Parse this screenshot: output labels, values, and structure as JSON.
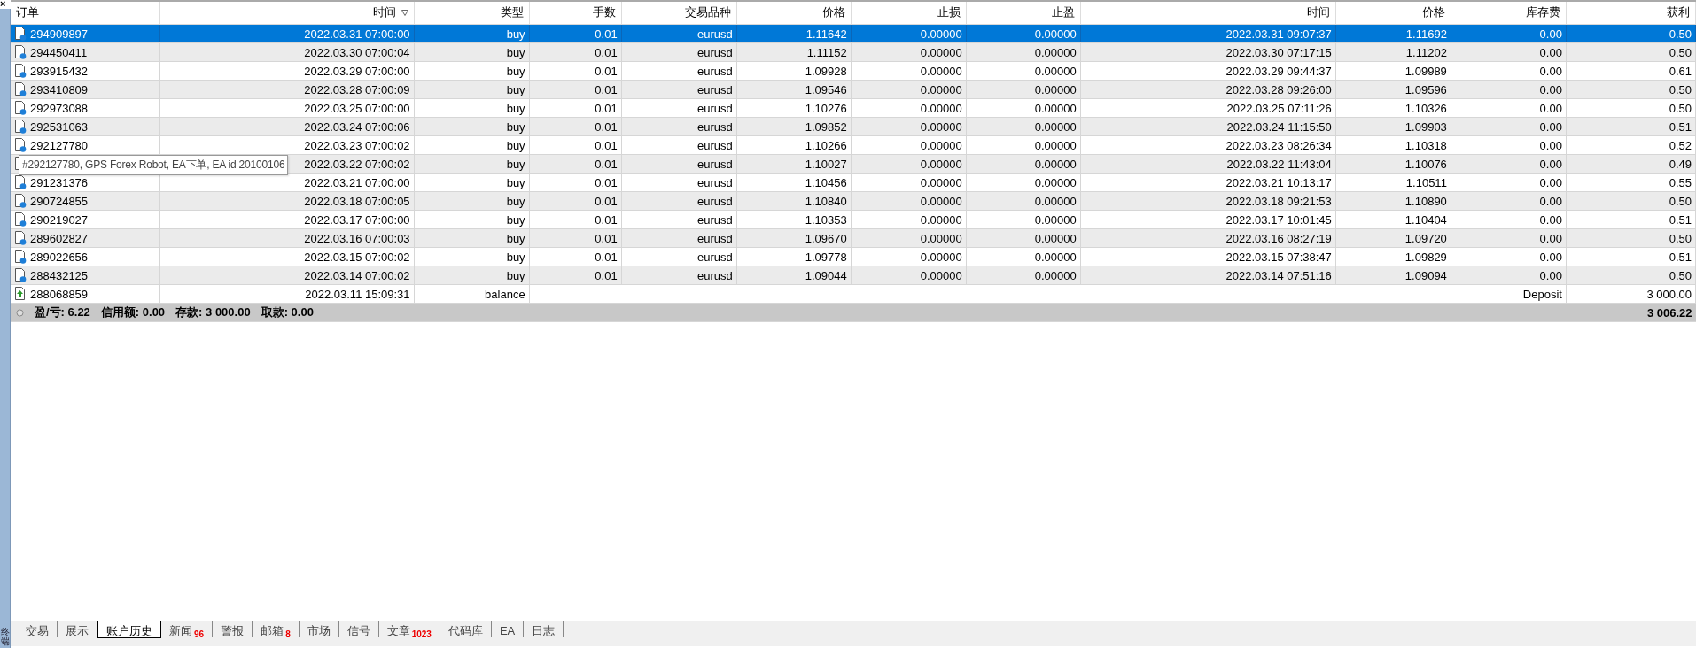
{
  "side_panel": {
    "close": "×",
    "label": "终端"
  },
  "table": {
    "columns": [
      {
        "label": "订单"
      },
      {
        "label": "时间",
        "sorted": true
      },
      {
        "label": "类型"
      },
      {
        "label": "手数"
      },
      {
        "label": "交易品种"
      },
      {
        "label": "价格"
      },
      {
        "label": "止损"
      },
      {
        "label": "止盈"
      },
      {
        "label": "时间"
      },
      {
        "label": "价格"
      },
      {
        "label": "库存费"
      },
      {
        "label": "获利"
      }
    ],
    "rows": [
      {
        "kind": "order",
        "selected": true,
        "cells": [
          "294909897",
          "2022.03.31 07:00:00",
          "buy",
          "0.01",
          "eurusd",
          "1.11642",
          "0.00000",
          "0.00000",
          "2022.03.31 09:07:37",
          "1.11692",
          "0.00",
          "0.50"
        ]
      },
      {
        "kind": "order",
        "selected": false,
        "cells": [
          "294450411",
          "2022.03.30 07:00:04",
          "buy",
          "0.01",
          "eurusd",
          "1.11152",
          "0.00000",
          "0.00000",
          "2022.03.30 07:17:15",
          "1.11202",
          "0.00",
          "0.50"
        ]
      },
      {
        "kind": "order",
        "selected": false,
        "cells": [
          "293915432",
          "2022.03.29 07:00:00",
          "buy",
          "0.01",
          "eurusd",
          "1.09928",
          "0.00000",
          "0.00000",
          "2022.03.29 09:44:37",
          "1.09989",
          "0.00",
          "0.61"
        ]
      },
      {
        "kind": "order",
        "selected": false,
        "cells": [
          "293410809",
          "2022.03.28 07:00:09",
          "buy",
          "0.01",
          "eurusd",
          "1.09546",
          "0.00000",
          "0.00000",
          "2022.03.28 09:26:00",
          "1.09596",
          "0.00",
          "0.50"
        ]
      },
      {
        "kind": "order",
        "selected": false,
        "cells": [
          "292973088",
          "2022.03.25 07:00:00",
          "buy",
          "0.01",
          "eurusd",
          "1.10276",
          "0.00000",
          "0.00000",
          "2022.03.25 07:11:26",
          "1.10326",
          "0.00",
          "0.50"
        ]
      },
      {
        "kind": "order",
        "selected": false,
        "cells": [
          "292531063",
          "2022.03.24 07:00:06",
          "buy",
          "0.01",
          "eurusd",
          "1.09852",
          "0.00000",
          "0.00000",
          "2022.03.24 11:15:50",
          "1.09903",
          "0.00",
          "0.51"
        ]
      },
      {
        "kind": "order",
        "selected": false,
        "cells": [
          "292127780",
          "2022.03.23 07:00:02",
          "buy",
          "0.01",
          "eurusd",
          "1.10266",
          "0.00000",
          "0.00000",
          "2022.03.23 08:26:34",
          "1.10318",
          "0.00",
          "0.52"
        ]
      },
      {
        "kind": "order",
        "selected": false,
        "cells": [
          "",
          "2022.03.22 07:00:02",
          "buy",
          "0.01",
          "eurusd",
          "1.10027",
          "0.00000",
          "0.00000",
          "2022.03.22 11:43:04",
          "1.10076",
          "0.00",
          "0.49"
        ]
      },
      {
        "kind": "order",
        "selected": false,
        "cells": [
          "291231376",
          "2022.03.21 07:00:00",
          "buy",
          "0.01",
          "eurusd",
          "1.10456",
          "0.00000",
          "0.00000",
          "2022.03.21 10:13:17",
          "1.10511",
          "0.00",
          "0.55"
        ]
      },
      {
        "kind": "order",
        "selected": false,
        "cells": [
          "290724855",
          "2022.03.18 07:00:05",
          "buy",
          "0.01",
          "eurusd",
          "1.10840",
          "0.00000",
          "0.00000",
          "2022.03.18 09:21:53",
          "1.10890",
          "0.00",
          "0.50"
        ]
      },
      {
        "kind": "order",
        "selected": false,
        "cells": [
          "290219027",
          "2022.03.17 07:00:00",
          "buy",
          "0.01",
          "eurusd",
          "1.10353",
          "0.00000",
          "0.00000",
          "2022.03.17 10:01:45",
          "1.10404",
          "0.00",
          "0.51"
        ]
      },
      {
        "kind": "order",
        "selected": false,
        "cells": [
          "289602827",
          "2022.03.16 07:00:03",
          "buy",
          "0.01",
          "eurusd",
          "1.09670",
          "0.00000",
          "0.00000",
          "2022.03.16 08:27:19",
          "1.09720",
          "0.00",
          "0.50"
        ]
      },
      {
        "kind": "order",
        "selected": false,
        "cells": [
          "289022656",
          "2022.03.15 07:00:02",
          "buy",
          "0.01",
          "eurusd",
          "1.09778",
          "0.00000",
          "0.00000",
          "2022.03.15 07:38:47",
          "1.09829",
          "0.00",
          "0.51"
        ]
      },
      {
        "kind": "order",
        "selected": false,
        "cells": [
          "288432125",
          "2022.03.14 07:00:02",
          "buy",
          "0.01",
          "eurusd",
          "1.09044",
          "0.00000",
          "0.00000",
          "2022.03.14 07:51:16",
          "1.09094",
          "0.00",
          "0.50"
        ]
      },
      {
        "kind": "balance",
        "selected": false,
        "cells": [
          "288068859",
          "2022.03.11 15:09:31",
          "balance",
          "",
          "",
          "",
          "",
          "",
          "",
          "",
          "Deposit",
          "3 000.00"
        ]
      }
    ],
    "summary": {
      "items": [
        "盈/亏: 6.22",
        "信用额: 0.00",
        "存款: 3 000.00",
        "取款: 0.00"
      ],
      "total": "3 006.22"
    }
  },
  "tooltip": {
    "text": "#292127780, GPS Forex Robot, EA下单, EA id 20100106"
  },
  "tabs": [
    {
      "label": "交易",
      "selected": false
    },
    {
      "label": "展示",
      "selected": false
    },
    {
      "label": "账户历史",
      "selected": true
    },
    {
      "label": "新闻",
      "selected": false,
      "badge": "96"
    },
    {
      "label": "警报",
      "selected": false
    },
    {
      "label": "邮箱",
      "selected": false,
      "badge": "8"
    },
    {
      "label": "市场",
      "selected": false
    },
    {
      "label": "信号",
      "selected": false
    },
    {
      "label": "文章",
      "selected": false,
      "badge": "1023"
    },
    {
      "label": "代码库",
      "selected": false
    },
    {
      "label": "EA",
      "selected": false
    },
    {
      "label": "日志",
      "selected": false
    }
  ]
}
